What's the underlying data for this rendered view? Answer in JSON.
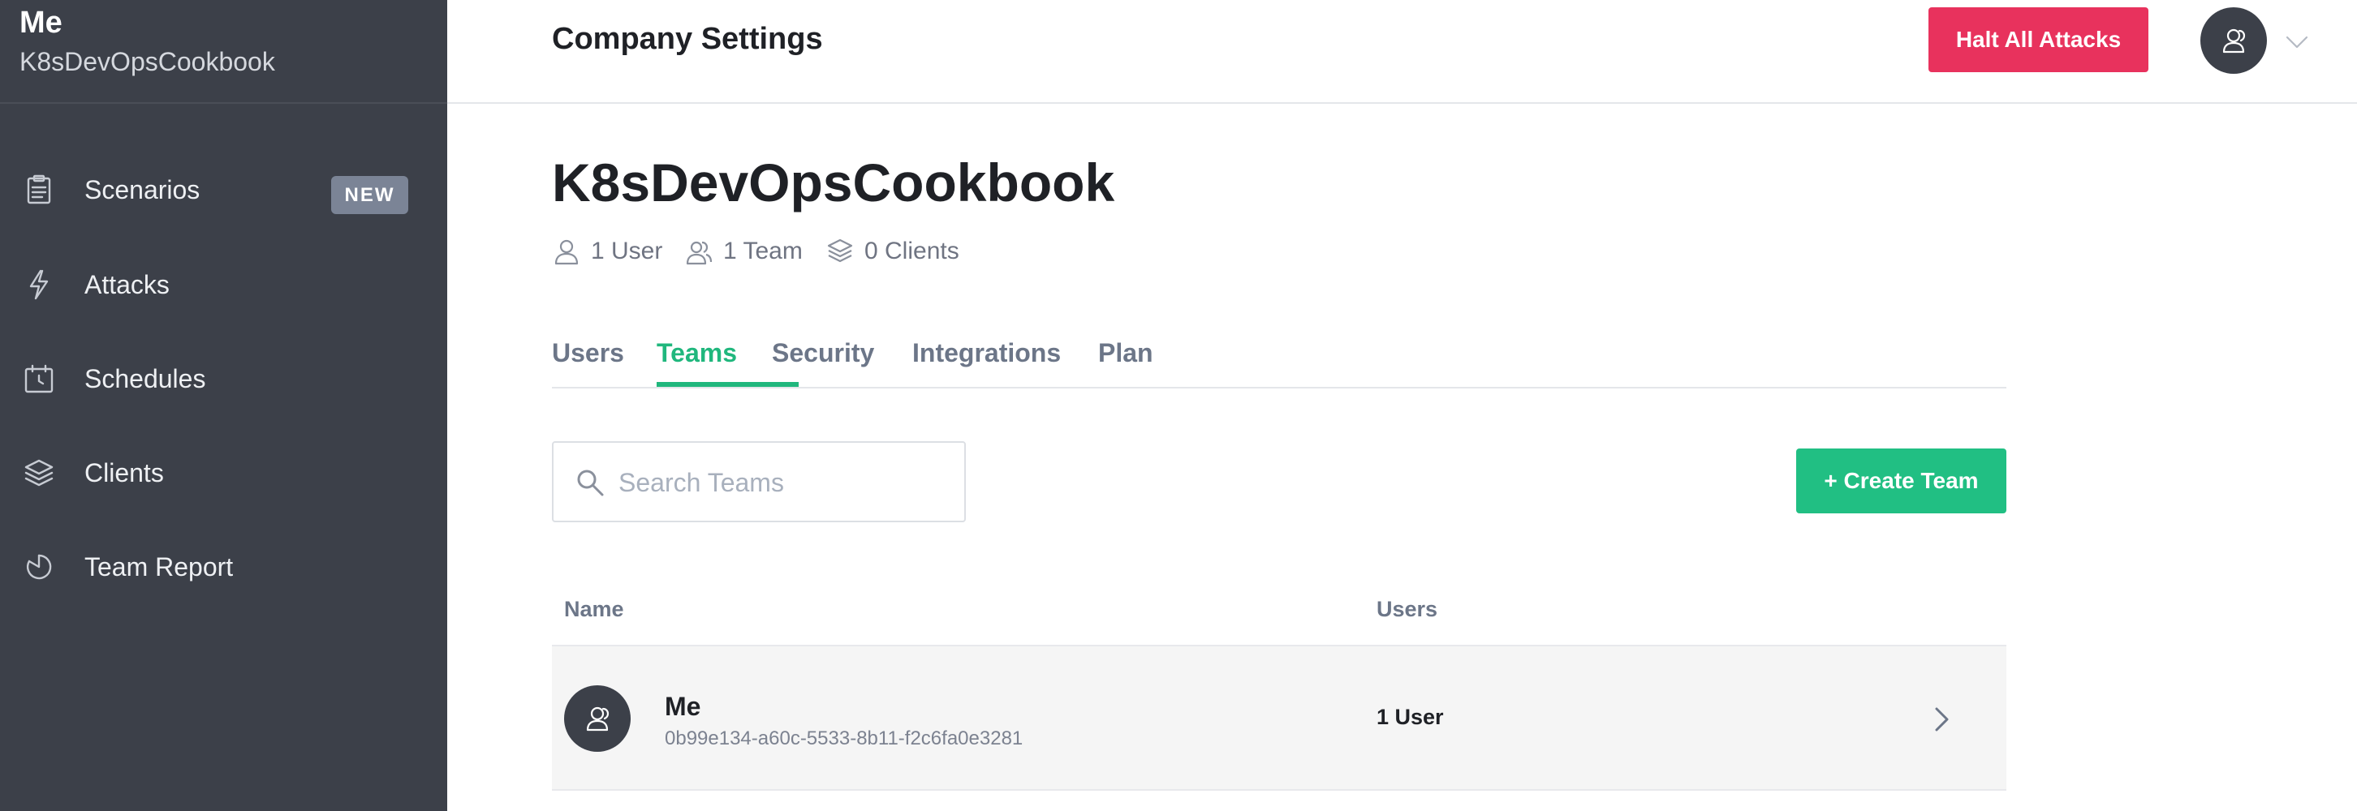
{
  "sidebar": {
    "brand_title": "Me",
    "brand_subtitle": "K8sDevOpsCookbook",
    "items": [
      {
        "label": "Scenarios",
        "icon": "clipboard-icon",
        "badge": "NEW"
      },
      {
        "label": "Attacks",
        "icon": "lightning-icon"
      },
      {
        "label": "Schedules",
        "icon": "calendar-clock-icon"
      },
      {
        "label": "Clients",
        "icon": "layers-icon"
      },
      {
        "label": "Team Report",
        "icon": "pie-chart-icon"
      }
    ]
  },
  "header": {
    "title": "Company Settings",
    "halt_label": "Halt All Attacks"
  },
  "company": {
    "name": "K8sDevOpsCookbook",
    "users_count": "1 User",
    "teams_count": "1 Team",
    "clients_count": "0 Clients"
  },
  "tabs": [
    {
      "label": "Users",
      "active": false
    },
    {
      "label": "Teams",
      "active": true
    },
    {
      "label": "Security",
      "active": false
    },
    {
      "label": "Integrations",
      "active": false
    },
    {
      "label": "Plan",
      "active": false
    }
  ],
  "search": {
    "placeholder": "Search Teams",
    "value": ""
  },
  "create_label": "+ Create Team",
  "table": {
    "columns": [
      "Name",
      "Users"
    ],
    "rows": [
      {
        "name": "Me",
        "id": "0b99e134-a60c-5533-8b11-f2c6fa0e3281",
        "users": "1 User"
      }
    ]
  },
  "colors": {
    "sidebar_bg": "#3c4049",
    "accent_green": "#21bf83",
    "danger_red": "#e8325d",
    "badge_gray": "#7b8496"
  }
}
